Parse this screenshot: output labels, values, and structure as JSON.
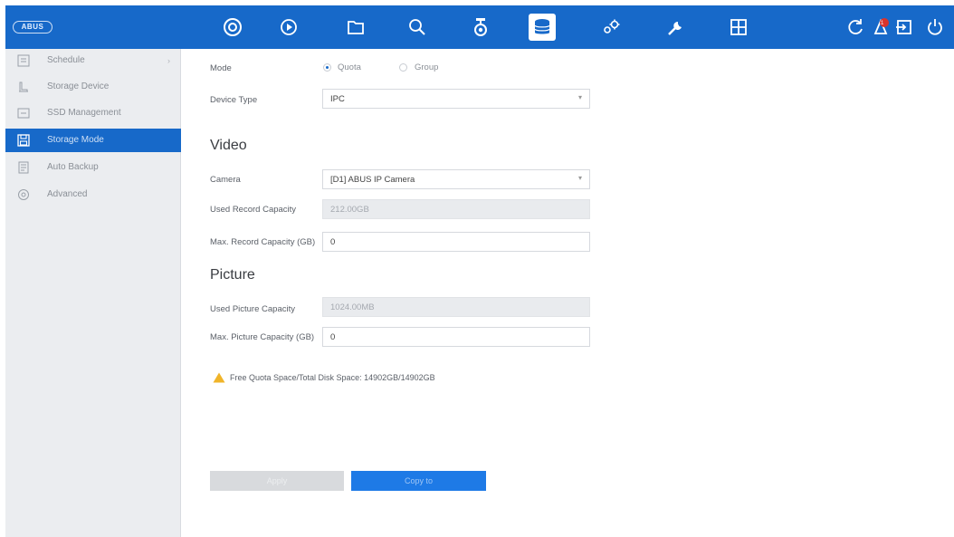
{
  "header": {
    "logo_text": "ABUS",
    "nav_icons": [
      "live-view-icon",
      "playback-icon",
      "file-management-icon",
      "smart-search-icon",
      "camera-icon",
      "storage-icon",
      "configuration-icon",
      "maintenance-icon",
      "split-screen-icon"
    ],
    "active_nav": "storage-icon",
    "right_icons": [
      "refresh-icon",
      "notification-icon",
      "logout-icon",
      "power-icon"
    ],
    "notification_badge": "1",
    "colors": {
      "bar": "#1769c9",
      "accent": "#1e7ae6"
    }
  },
  "sidebar": {
    "items": [
      {
        "label": "Schedule",
        "icon": "schedule-icon",
        "has_chevron": true
      },
      {
        "label": "Storage Device",
        "icon": "storage-device-icon"
      },
      {
        "label": "SSD Management",
        "icon": "ssd-icon"
      },
      {
        "label": "Storage Mode",
        "icon": "storage-mode-icon",
        "active": true
      },
      {
        "label": "Auto Backup",
        "icon": "backup-icon"
      },
      {
        "label": "Advanced",
        "icon": "advanced-icon"
      }
    ]
  },
  "form": {
    "mode_label": "Mode",
    "mode_options": [
      "Quota",
      "Group"
    ],
    "mode_selected": "Quota",
    "device_type_label": "Device Type",
    "device_type_value": "IPC",
    "video_title": "Video",
    "camera_label": "Camera",
    "camera_value": "[D1] ABUS IP Camera",
    "used_record_label": "Used Record Capacity",
    "used_record_value": "212.00GB",
    "max_record_label": "Max. Record Capacity (GB)",
    "max_record_value": "0",
    "picture_title": "Picture",
    "used_picture_label": "Used Picture Capacity",
    "used_picture_value": "1024.00MB",
    "max_picture_label": "Max. Picture Capacity (GB)",
    "max_picture_value": "0",
    "info_text": "Free Quota Space/Total Disk Space: 14902GB/14902GB"
  },
  "buttons": {
    "apply_label": "Apply",
    "copy_label": "Copy to"
  }
}
